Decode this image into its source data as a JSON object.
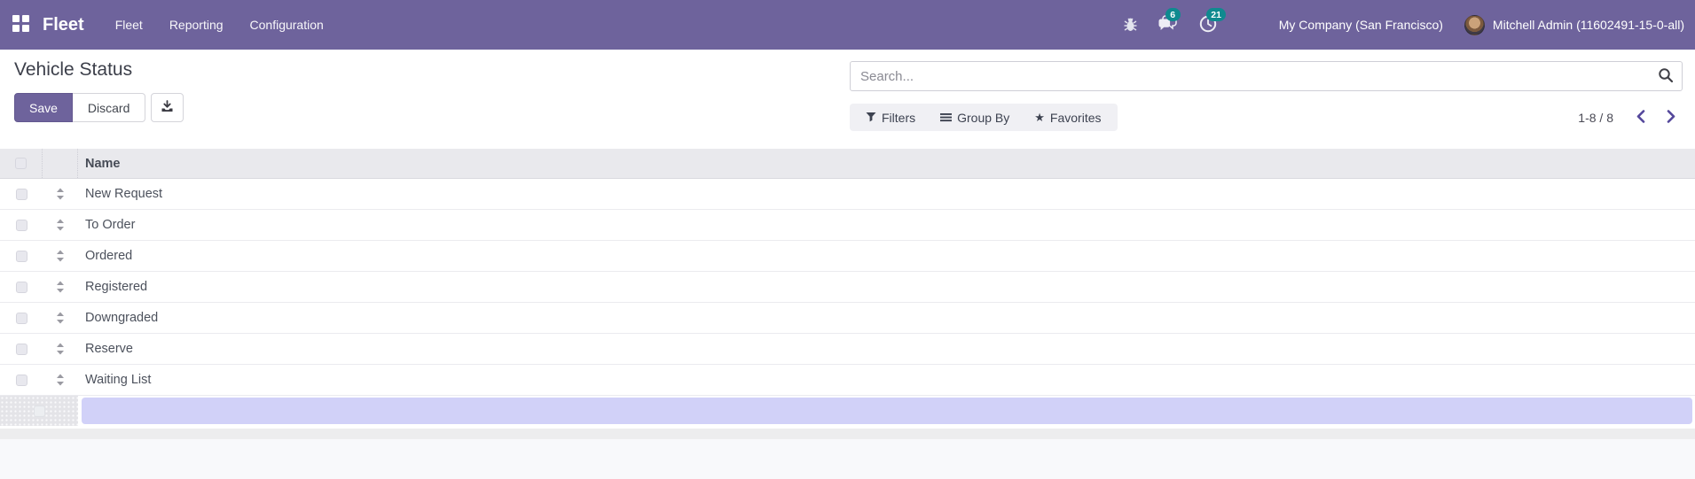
{
  "navbar": {
    "brand": "Fleet",
    "menus": [
      {
        "label": "Fleet"
      },
      {
        "label": "Reporting"
      },
      {
        "label": "Configuration"
      }
    ],
    "systray": {
      "messages_badge": "6",
      "activities_badge": "21",
      "company": "My Company (San Francisco)",
      "user": "Mitchell Admin (11602491-15-0-all)"
    }
  },
  "control_panel": {
    "title": "Vehicle Status",
    "save_label": "Save",
    "discard_label": "Discard",
    "search_placeholder": "Search...",
    "filters_label": "Filters",
    "group_by_label": "Group By",
    "favorites_label": "Favorites",
    "pager_range": "1-8 / 8"
  },
  "icons": {
    "favorites_star": "★"
  },
  "table": {
    "columns": [
      "Name"
    ],
    "rows": [
      "New Request",
      "To Order",
      "Ordered",
      "Registered",
      "Downgraded",
      "Reserve",
      "Waiting List"
    ],
    "new_row_value": ""
  },
  "colors": {
    "navbar": "#6e639c",
    "primary_button": "#6e639c",
    "badge": "#0f8a8f",
    "new_row_highlight": "#d1d1f8"
  }
}
